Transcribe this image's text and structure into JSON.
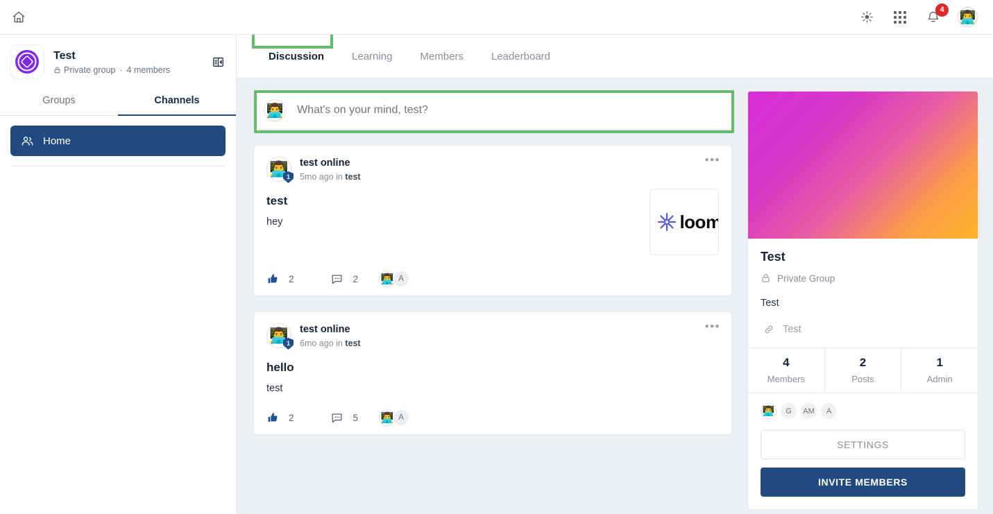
{
  "topbar": {
    "home_icon": "home-icon",
    "theme_icon": "sun-icon",
    "apps_icon": "grid-apps-icon",
    "bell_icon": "bell-icon",
    "notification_count": "4",
    "avatar_glyph": "👨‍💻"
  },
  "sidebar": {
    "group_name": "Test",
    "privacy": "Private group",
    "separator": "·",
    "members": "4 members",
    "collapse_icon": "panel-collapse-icon",
    "tabs": [
      {
        "label": "Groups",
        "active": false
      },
      {
        "label": "Channels",
        "active": true
      }
    ],
    "items": [
      {
        "label": "Home",
        "icon": "people-icon",
        "active": true
      }
    ]
  },
  "tabs": [
    {
      "label": "Discussion",
      "active": true
    },
    {
      "label": "Learning",
      "active": false
    },
    {
      "label": "Members",
      "active": false
    },
    {
      "label": "Leaderboard",
      "active": false
    }
  ],
  "composer": {
    "avatar_glyph": "👨‍💻",
    "placeholder": "What's on your mind, test?",
    "value": ""
  },
  "posts": [
    {
      "author": "test online",
      "avatar_glyph": "👨‍💻",
      "badge": "1",
      "time": "5mo ago in ",
      "channel": "test",
      "title": "test",
      "text": "hey",
      "likes": "2",
      "comments": "2",
      "more_icon": "ellipsis-icon",
      "like_icon": "thumbs-up-icon",
      "comment_icon": "comment-bubble-icon",
      "thumbnail": "loom",
      "reactors": [
        "👨‍💻",
        "A"
      ]
    },
    {
      "author": "test online",
      "avatar_glyph": "👨‍💻",
      "badge": "1",
      "time": "6mo ago in ",
      "channel": "test",
      "title": "hello",
      "text": "test",
      "likes": "2",
      "comments": "5",
      "more_icon": "ellipsis-icon",
      "like_icon": "thumbs-up-icon",
      "comment_icon": "comment-bubble-icon",
      "thumbnail": "",
      "reactors": [
        "👨‍💻",
        "A"
      ]
    }
  ],
  "right_panel": {
    "title": "Test",
    "privacy": "Private Group",
    "privacy_icon": "lock-icon",
    "description": "Test",
    "link_icon": "link-icon",
    "link_text": "Test",
    "stats": [
      {
        "num": "4",
        "label": "Members"
      },
      {
        "num": "2",
        "label": "Posts"
      },
      {
        "num": "1",
        "label": "Admin"
      }
    ],
    "member_avatars": [
      "👨‍💻",
      "G",
      "AM",
      "A"
    ],
    "settings_label": "SETTINGS",
    "invite_label": "INVITE MEMBERS"
  },
  "colors": {
    "accent_blue": "#234a80",
    "highlight_green": "#67bb6c",
    "badge_red": "#e02828",
    "logo_purple": "#7c2ae8"
  }
}
